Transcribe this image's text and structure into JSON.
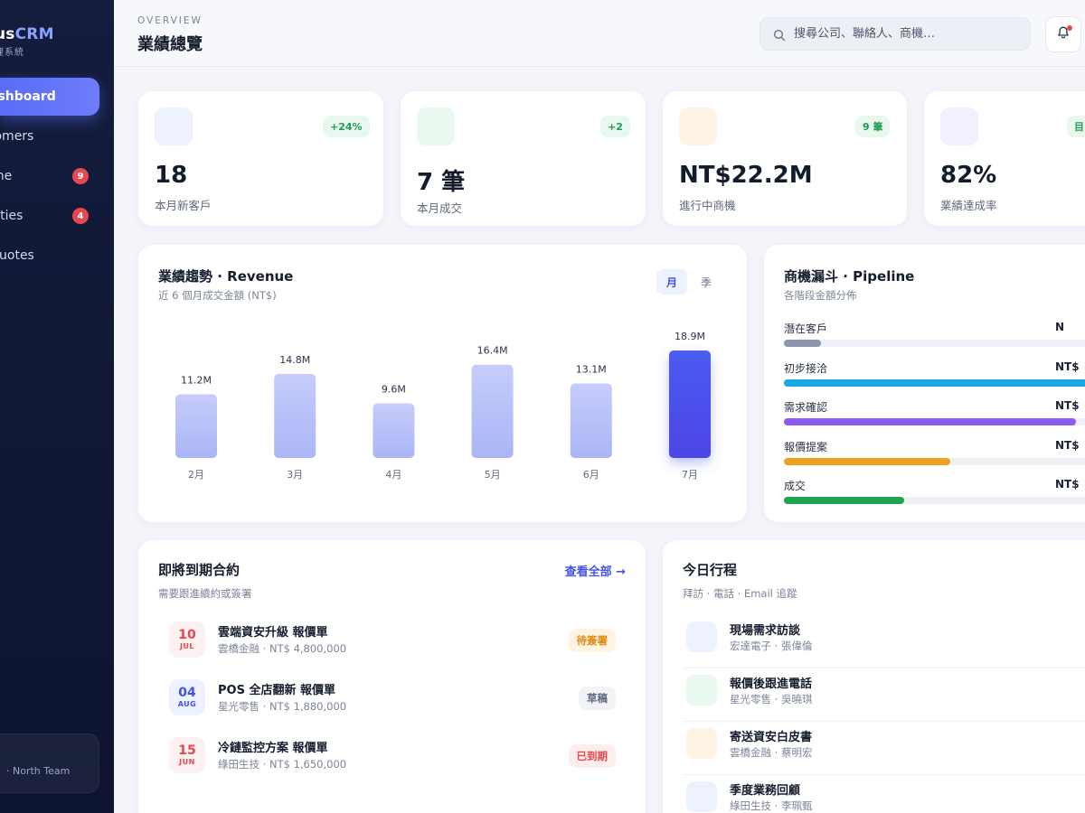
{
  "brand": {
    "name_prefix": "us",
    "name_accent": "CRM",
    "subtitle": "理系統"
  },
  "nav": {
    "items": [
      {
        "label": "ashboard",
        "badge": null,
        "active": true
      },
      {
        "label": "tomers",
        "badge": null,
        "active": false
      },
      {
        "label": "line",
        "badge": "9",
        "active": false
      },
      {
        "label": "vities",
        "badge": "4",
        "active": false
      },
      {
        "label": "Quotes",
        "badge": null,
        "active": false
      }
    ],
    "team": "· North Team"
  },
  "header": {
    "eyebrow": "OVERVIEW",
    "title": "業績總覽",
    "search_placeholder": "搜尋公司、聯絡人、商機…"
  },
  "kpis": [
    {
      "value": "18",
      "label": "本月新客戶",
      "badge": "+24%",
      "icon_color": "#eef2ff"
    },
    {
      "value": "7 筆",
      "label": "本月成交",
      "badge": "+2",
      "icon_color": "#e9f9ef"
    },
    {
      "value": "NT$22.2M",
      "label": "進行中商機",
      "badge": "9 筆",
      "icon_color": "#fff3e6"
    },
    {
      "value": "82%",
      "label": "業績達成率",
      "badge": "目",
      "icon_color": "#f3efff"
    }
  ],
  "revenue": {
    "title": "業績趨勢 · Revenue",
    "subtitle": "近 6 個月成交金額 (NT$)",
    "toggle": {
      "month": "月",
      "quarter": "季"
    }
  },
  "chart_data": {
    "type": "bar",
    "categories": [
      "2月",
      "3月",
      "4月",
      "5月",
      "6月",
      "7月"
    ],
    "values": [
      11.2,
      14.8,
      9.6,
      16.4,
      13.1,
      18.9
    ],
    "labels": [
      "11.2M",
      "14.8M",
      "9.6M",
      "16.4M",
      "13.1M",
      "18.9M"
    ],
    "title": "業績趨勢 · Revenue",
    "xlabel": "",
    "ylabel": "",
    "unit": "M",
    "highlight_index": 5,
    "bar_color": "#b9c3fb",
    "highlight_color": "#4c58ee",
    "grid": false
  },
  "pipeline": {
    "title": "商機漏斗 · Pipeline",
    "subtitle": "各階段金額分佈",
    "stages": [
      {
        "name": "潛在客戶",
        "value": "N",
        "fraction": 0.12,
        "color": "#8f96ab"
      },
      {
        "name": "初步接洽",
        "value": "NT$",
        "fraction": 1.0,
        "color": "#1aa6de"
      },
      {
        "name": "需求確認",
        "value": "NT$",
        "fraction": 0.95,
        "color": "#8a5cf0"
      },
      {
        "name": "報價提案",
        "value": "NT$",
        "fraction": 0.54,
        "color": "#f0a020"
      },
      {
        "name": "成交",
        "value": "NT$",
        "fraction": 0.39,
        "color": "#1fa34f"
      }
    ]
  },
  "contracts": {
    "title": "即將到期合約",
    "subtitle": "需要跟進續約或簽署",
    "view_all": "查看全部 →",
    "items": [
      {
        "day": "10",
        "month": "JUL",
        "title": "雲端資安升級 報價單",
        "sub": "雲橋金融 · NT$ 4,800,000",
        "status": "待簽署",
        "date_color": "#e5484d",
        "date_bg": "#fdf0f0",
        "status_color": "#e08a12",
        "status_bg": "#fff4e2"
      },
      {
        "day": "04",
        "month": "AUG",
        "title": "POS 全店翻新 報價單",
        "sub": "星光零售 · NT$ 1,880,000",
        "status": "草稿",
        "date_color": "#4254e6",
        "date_bg": "#eef1ff",
        "status_color": "#5f687c",
        "status_bg": "#f1f3f7"
      },
      {
        "day": "15",
        "month": "JUN",
        "title": "冷鏈監控方案 報價單",
        "sub": "綠田生技 · NT$ 1,650,000",
        "status": "已到期",
        "date_color": "#e5484d",
        "date_bg": "#fdf0f0",
        "status_color": "#e5484d",
        "status_bg": "#fdeeee"
      }
    ]
  },
  "schedule": {
    "title": "今日行程",
    "subtitle": "拜訪 · 電話 · Email 追蹤",
    "items": [
      {
        "title": "現場需求訪談",
        "sub": "宏達電子 · 張偉倫",
        "icon_color": "#eef2ff"
      },
      {
        "title": "報價後跟進電話",
        "sub": "星光零售 · 吳曉琪",
        "icon_color": "#e9f9ef"
      },
      {
        "title": "寄送資安白皮書",
        "sub": "雲橋金融 · 蔡明宏",
        "icon_color": "#fff3e6"
      },
      {
        "title": "季度業務回顧",
        "sub": "綠田生技 · 李珮甄",
        "icon_color": "#eef2ff"
      }
    ]
  }
}
